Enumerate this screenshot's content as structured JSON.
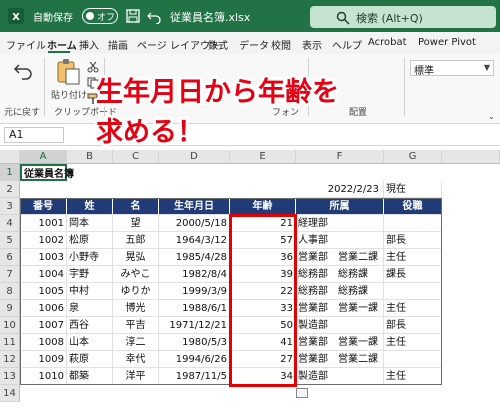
{
  "titlebar": {
    "autosave_label": "自動保存",
    "autosave_state": "オフ",
    "filename": "従業員名簿.xlsx",
    "search_placeholder": "検索 (Alt+Q)"
  },
  "menu": {
    "items": [
      "ファイル",
      "ホーム",
      "挿入",
      "描画",
      "ページ レイアウト",
      "数式",
      "データ",
      "校閲",
      "表示",
      "ヘルプ",
      "Acrobat",
      "Power Pivot"
    ],
    "active": "ホーム"
  },
  "ribbon": {
    "undo_group": "元に戻す",
    "paste_label": "貼り付け",
    "clipboard_group": "クリップボード",
    "font_group": "フォン",
    "align_group": "配置",
    "number_format": "標準"
  },
  "formula_bar": {
    "name_box": "A1",
    "fx": "fx"
  },
  "sheet": {
    "columns": [
      "A",
      "B",
      "C",
      "D",
      "E",
      "F",
      "G"
    ],
    "rows": [
      "1",
      "2",
      "3",
      "4",
      "5",
      "6",
      "7",
      "8",
      "9",
      "10",
      "11",
      "12",
      "13",
      "14"
    ],
    "title": "従業員名簿",
    "date_value": "2022/2/23",
    "date_suffix": "現在",
    "headers": [
      "番号",
      "姓",
      "名",
      "生年月日",
      "年齢",
      "所属",
      "役職"
    ],
    "records": [
      [
        "1001",
        "岡本",
        "望",
        "2000/5/18",
        "21",
        "経理部",
        ""
      ],
      [
        "1002",
        "松原",
        "五郎",
        "1964/3/12",
        "57",
        "人事部",
        "部長"
      ],
      [
        "1003",
        "小野寺",
        "晃弘",
        "1985/4/28",
        "36",
        "営業部　営業二課",
        "主任"
      ],
      [
        "1004",
        "宇野",
        "みやこ",
        "1982/8/4",
        "39",
        "総務部　総務課",
        "課長"
      ],
      [
        "1005",
        "中村",
        "ゆりか",
        "1999/3/9",
        "22",
        "総務部　総務課",
        ""
      ],
      [
        "1006",
        "泉",
        "博光",
        "1988/6/1",
        "33",
        "営業部　営業一課",
        "主任"
      ],
      [
        "1007",
        "西谷",
        "平吉",
        "1971/12/21",
        "50",
        "製造部",
        "部長"
      ],
      [
        "1008",
        "山本",
        "淳二",
        "1980/5/3",
        "41",
        "営業部　営業一課",
        "主任"
      ],
      [
        "1009",
        "萩原",
        "幸代",
        "1994/6/26",
        "27",
        "営業部　営業二課",
        ""
      ],
      [
        "1010",
        "都築",
        "洋平",
        "1987/11/5",
        "34",
        "製造部",
        "主任"
      ]
    ]
  },
  "overlay": {
    "line1": "生年月日から年齢を",
    "line2": "求める！"
  },
  "colors": {
    "excel_green": "#217346",
    "header_navy": "#203b78",
    "highlight_red": "#e60000"
  },
  "icons": [
    "excel-logo-icon",
    "save-icon",
    "undo-icon",
    "search-icon",
    "paste-icon",
    "cut-icon",
    "copy-icon",
    "format-painter-icon",
    "ribbon-expand-icon"
  ]
}
